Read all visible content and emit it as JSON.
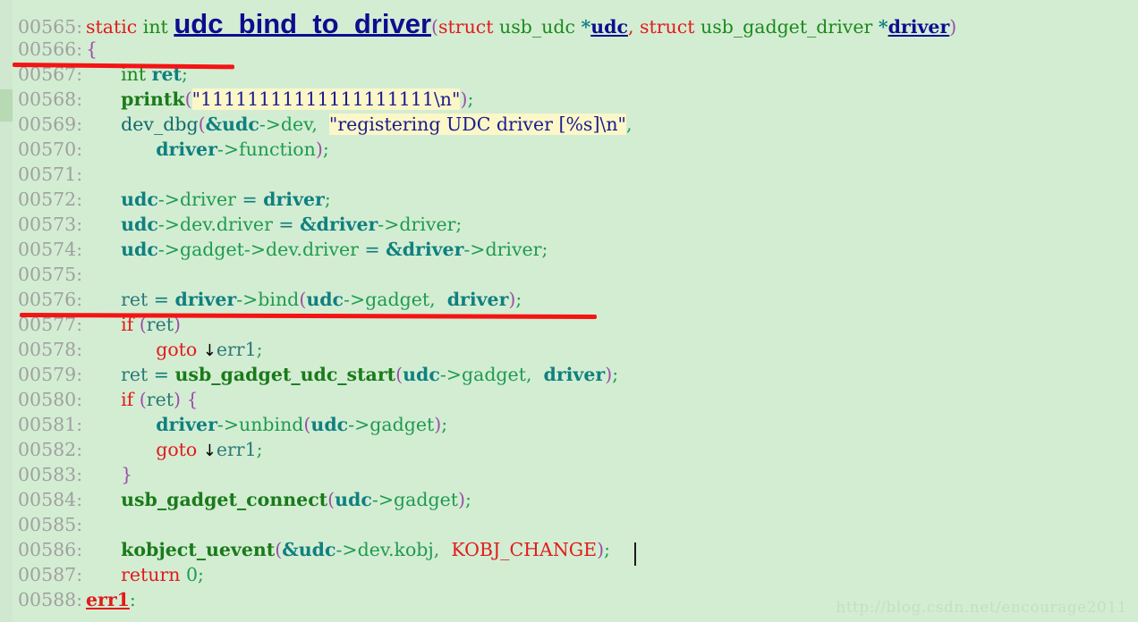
{
  "window": {
    "title": "udc_bind_to_driver source view",
    "background_color": "#d3edd3",
    "gutter_color": "#cfe8cf",
    "gutter_mark_color": "#b7d9b4",
    "annotation_color": "#f41414",
    "string_highlight_color": "#fbf7c8"
  },
  "watermark": {
    "text": "http://blog.csdn.net/encourage2011"
  },
  "caret": {
    "line": "00586",
    "after": ");"
  },
  "annotations": [
    {
      "name": "red-underline-line-566",
      "target_line": "00566"
    },
    {
      "name": "red-underline-line-576",
      "target_line": "00576"
    }
  ],
  "code": {
    "line_numbers": [
      "00565:",
      "00566:",
      "00567:",
      "00568:",
      "00569:",
      "00570:",
      "00571:",
      "00572:",
      "00573:",
      "00574:",
      "00575:",
      "00576:",
      "00577:",
      "00578:",
      "00579:",
      "00580:",
      "00581:",
      "00582:",
      "00583:",
      "00584:",
      "00585:",
      "00586:",
      "00587:",
      "00588:"
    ],
    "lines": {
      "l565": {
        "kw_static": "static",
        "typ_int": "int",
        "fname": "udc_bind_to_driver",
        "p_open": "(",
        "kw_struct1": "struct",
        "typ_usb_udc": "usb_udc",
        "star1": "*",
        "arg_udc": "udc",
        "comma1": ", ",
        "kw_struct2": "struct",
        "typ_gadget_driver": "usb_gadget_driver",
        "star2": "*",
        "arg_driver": "driver",
        "p_close": ")"
      },
      "l566": {
        "brace": "{"
      },
      "l567": {
        "typ": "int",
        "var": "ret",
        "semi": ";"
      },
      "l568": {
        "fn": "printk",
        "p_open": "(",
        "str": "\"11111111111111111111\\n\"",
        "p_close": ")",
        "semi": ";"
      },
      "l569": {
        "fn": "dev_dbg",
        "p_open": "(",
        "amp_udc": "&udc",
        "arrow": "->",
        "mem": "dev",
        "comma": ",  ",
        "str": "\"registering UDC driver [%s]\\n\"",
        "comma2": ","
      },
      "l570": {
        "var": "driver",
        "arrow": "->",
        "mem": "function",
        "p_close": ")",
        "semi": ";"
      },
      "l571": {
        "blank": ""
      },
      "l572": {
        "var": "udc",
        "arrow": "->",
        "mem": "driver",
        "eq": " = ",
        "rhs": "driver",
        "semi": ";"
      },
      "l573": {
        "var": "udc",
        "arrow": "->",
        "mem": "dev.driver",
        "eq": " = ",
        "amp": "&",
        "rhs": "driver",
        "arrow2": "->",
        "mem2": "driver",
        "semi": ";"
      },
      "l574": {
        "var": "udc",
        "arrow": "->",
        "mem": "gadget",
        "arrow2": "->",
        "mem2": "dev.driver",
        "eq": " = ",
        "amp": "&",
        "rhs": "driver",
        "arrow3": "->",
        "mem3": "driver",
        "semi": ";"
      },
      "l575": {
        "blank": ""
      },
      "l576": {
        "ret": "ret",
        "eq": " = ",
        "var": "driver",
        "arrow": "->",
        "fn": "bind",
        "p_open": "(",
        "arg1": "udc",
        "arrow2": "->",
        "mem": "gadget",
        "comma": ",  ",
        "arg2": "driver",
        "p_close": ")",
        "semi": ";"
      },
      "l577": {
        "kw": "if",
        "p_open": " (",
        "cond": "ret",
        "p_close": ")"
      },
      "l578": {
        "kw": "goto",
        "arrow_glyph": "↓",
        "label": "err1",
        "semi": ";"
      },
      "l579": {
        "ret": "ret",
        "eq": " = ",
        "fn": "usb_gadget_udc_start",
        "p_open": "(",
        "arg1": "udc",
        "arrow": "->",
        "mem": "gadget",
        "comma": ",  ",
        "arg2": "driver",
        "p_close": ")",
        "semi": ";"
      },
      "l580": {
        "kw": "if",
        "p_open": " (",
        "cond": "ret",
        "p_close": ")",
        "brace": " {"
      },
      "l581": {
        "var": "driver",
        "arrow": "->",
        "fn": "unbind",
        "p_open": "(",
        "arg1": "udc",
        "arrow2": "->",
        "mem": "gadget",
        "p_close": ")",
        "semi": ";"
      },
      "l582": {
        "kw": "goto",
        "arrow_glyph": "↓",
        "label": "err1",
        "semi": ";"
      },
      "l583": {
        "brace": "}"
      },
      "l584": {
        "fn": "usb_gadget_connect",
        "p_open": "(",
        "arg1": "udc",
        "arrow": "->",
        "mem": "gadget",
        "p_close": ")",
        "semi": ";"
      },
      "l585": {
        "blank": ""
      },
      "l586": {
        "fn": "kobject_uevent",
        "p_open": "(",
        "amp_udc": "&udc",
        "arrow": "->",
        "mem": "dev.kobj",
        "comma": ",  ",
        "macro": "KOBJ_CHANGE",
        "p_close": ")",
        "semi": ";"
      },
      "l587": {
        "kw": "return",
        "num": " 0",
        "semi": ";"
      },
      "l588": {
        "label": "err1",
        "colon": ":"
      }
    }
  }
}
